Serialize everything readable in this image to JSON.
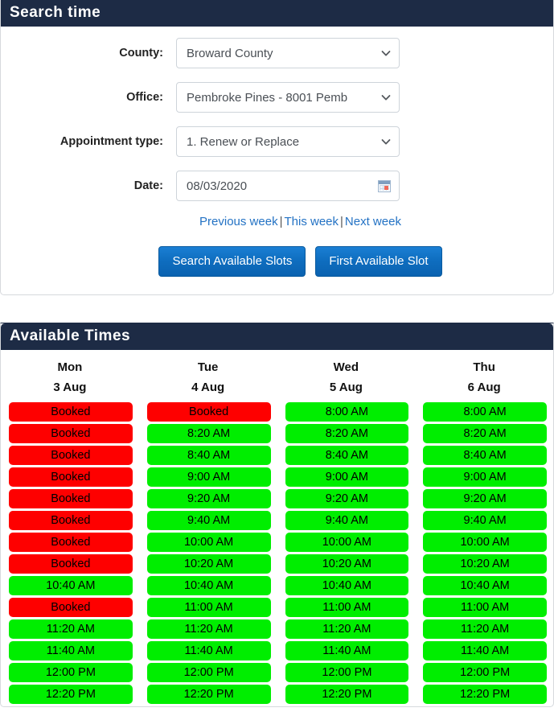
{
  "search_panel": {
    "title": "Search time",
    "fields": [
      {
        "label": "County:",
        "value": "Broward County",
        "name": "county"
      },
      {
        "label": "Office:",
        "value": "Pembroke Pines - 8001 Pemb",
        "name": "office"
      },
      {
        "label": "Appointment type:",
        "value": "1. Renew or Replace",
        "name": "appointment-type"
      },
      {
        "label": "Date:",
        "value": "08/03/2020",
        "name": "date"
      }
    ],
    "week_links": {
      "previous": "Previous week",
      "this": "This week",
      "next": "Next week",
      "separator": "|"
    },
    "buttons": {
      "search": "Search Available Slots",
      "first": "First Available Slot"
    }
  },
  "times_panel": {
    "title": "Available Times",
    "columns": [
      {
        "dow": "Mon",
        "date": "3 Aug"
      },
      {
        "dow": "Tue",
        "date": "4 Aug"
      },
      {
        "dow": "Wed",
        "date": "5 Aug"
      },
      {
        "dow": "Thu",
        "date": "6 Aug"
      }
    ],
    "booked_label": "Booked",
    "rows": [
      [
        "Booked",
        "Booked",
        "8:00 AM",
        "8:00 AM"
      ],
      [
        "Booked",
        "8:20 AM",
        "8:20 AM",
        "8:20 AM"
      ],
      [
        "Booked",
        "8:40 AM",
        "8:40 AM",
        "8:40 AM"
      ],
      [
        "Booked",
        "9:00 AM",
        "9:00 AM",
        "9:00 AM"
      ],
      [
        "Booked",
        "9:20 AM",
        "9:20 AM",
        "9:20 AM"
      ],
      [
        "Booked",
        "9:40 AM",
        "9:40 AM",
        "9:40 AM"
      ],
      [
        "Booked",
        "10:00 AM",
        "10:00 AM",
        "10:00 AM"
      ],
      [
        "Booked",
        "10:20 AM",
        "10:20 AM",
        "10:20 AM"
      ],
      [
        "10:40 AM",
        "10:40 AM",
        "10:40 AM",
        "10:40 AM"
      ],
      [
        "Booked",
        "11:00 AM",
        "11:00 AM",
        "11:00 AM"
      ],
      [
        "11:20 AM",
        "11:20 AM",
        "11:20 AM",
        "11:20 AM"
      ],
      [
        "11:40 AM",
        "11:40 AM",
        "11:40 AM",
        "11:40 AM"
      ],
      [
        "12:00 PM",
        "12:00 PM",
        "12:00 PM",
        "12:00 PM"
      ],
      [
        "12:20 PM",
        "12:20 PM",
        "12:20 PM",
        "12:20 PM"
      ]
    ]
  },
  "colors": {
    "header_bg": "#1d2b45",
    "open_slot": "#00ee00",
    "booked_slot": "#fe0000",
    "link": "#2372c4",
    "button": "#0f6ec0"
  }
}
